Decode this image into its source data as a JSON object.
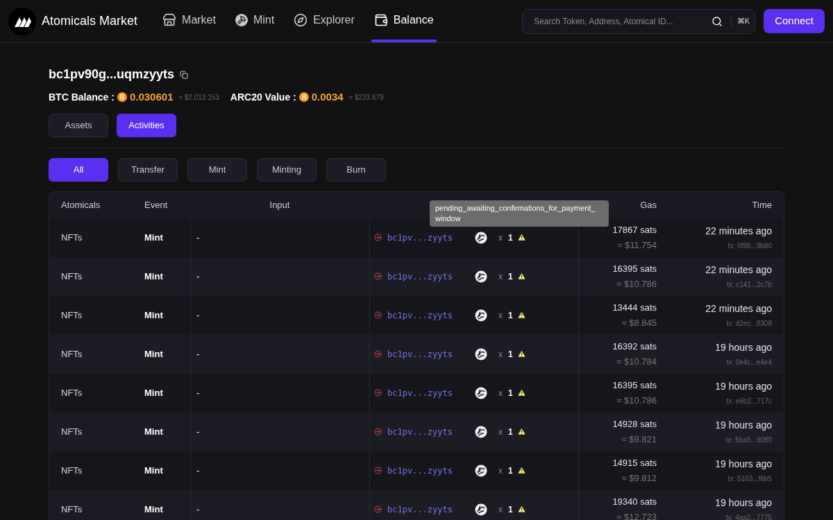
{
  "nav": {
    "brand": "Atomicals Market",
    "items": [
      {
        "label": "Market",
        "kind": "market",
        "selected": false
      },
      {
        "label": "Mint",
        "kind": "mint",
        "selected": false
      },
      {
        "label": "Explorer",
        "kind": "explorer",
        "selected": false
      },
      {
        "label": "Balance",
        "kind": "balance",
        "selected": true
      }
    ],
    "search": {
      "placeholder": "Search Token, Address, Atomical ID...",
      "shortcut": "⌘K"
    },
    "connect": "Connect"
  },
  "wallet": {
    "address": "bc1pv90g...uqmzyyts",
    "balances": [
      {
        "label": "BTC Balance :",
        "value": "0.030601",
        "usd": "≈ $2,013.153"
      },
      {
        "label": "ARC20 Value :",
        "value": "0.0034",
        "usd": "≈ $223.679"
      }
    ]
  },
  "tabs": [
    {
      "label": "Assets",
      "selected": false
    },
    {
      "label": "Activities",
      "selected": true
    }
  ],
  "filters": [
    {
      "label": "All",
      "selected": true
    },
    {
      "label": "Transfer",
      "selected": false
    },
    {
      "label": "Mint",
      "selected": false
    },
    {
      "label": "Minting",
      "selected": false
    },
    {
      "label": "Burn",
      "selected": false
    }
  ],
  "table": {
    "columns": [
      "Atomicals",
      "Event",
      "Input",
      "Gas",
      "Time"
    ],
    "tooltip": "pending_awaiting_confirmations_for_payment_ window",
    "rows": [
      {
        "atomicals": "NFTs",
        "event": "Mint",
        "input": "-",
        "output": "bc1pv...zyyts",
        "multiplier": "x",
        "count": "1",
        "gas": "17867 sats",
        "gas_usd": "≈ $11.754",
        "time": "22 minutes ago",
        "tx": "tx: 6f99...9b80"
      },
      {
        "atomicals": "NFTs",
        "event": "Mint",
        "input": "-",
        "output": "bc1pv...zyyts",
        "multiplier": "x",
        "count": "1",
        "gas": "16395 sats",
        "gas_usd": "≈ $10.786",
        "time": "22 minutes ago",
        "tx": "tx: c141...2c7b"
      },
      {
        "atomicals": "NFTs",
        "event": "Mint",
        "input": "-",
        "output": "bc1pv...zyyts",
        "multiplier": "x",
        "count": "1",
        "gas": "13444 sats",
        "gas_usd": "≈ $8.845",
        "time": "22 minutes ago",
        "tx": "tx: d2ec...8308"
      },
      {
        "atomicals": "NFTs",
        "event": "Mint",
        "input": "-",
        "output": "bc1pv...zyyts",
        "multiplier": "x",
        "count": "1",
        "gas": "16392 sats",
        "gas_usd": "≈ $10.784",
        "time": "19 hours ago",
        "tx": "tx: 0e4c...e4e4"
      },
      {
        "atomicals": "NFTs",
        "event": "Mint",
        "input": "-",
        "output": "bc1pv...zyyts",
        "multiplier": "x",
        "count": "1",
        "gas": "16395 sats",
        "gas_usd": "≈ $10.786",
        "time": "19 hours ago",
        "tx": "tx: e6b2...717c"
      },
      {
        "atomicals": "NFTs",
        "event": "Mint",
        "input": "-",
        "output": "bc1pv...zyyts",
        "multiplier": "x",
        "count": "1",
        "gas": "14928 sats",
        "gas_usd": "≈ $9.821",
        "time": "19 hours ago",
        "tx": "tx: 5ba9...9080"
      },
      {
        "atomicals": "NFTs",
        "event": "Mint",
        "input": "-",
        "output": "bc1pv...zyyts",
        "multiplier": "x",
        "count": "1",
        "gas": "14915 sats",
        "gas_usd": "≈ $9.812",
        "time": "19 hours ago",
        "tx": "tx: 5103...f6b5"
      },
      {
        "atomicals": "NFTs",
        "event": "Mint",
        "input": "-",
        "output": "bc1pv...zyyts",
        "multiplier": "x",
        "count": "1",
        "gas": "19340 sats",
        "gas_usd": "≈ $12.723",
        "time": "19 hours ago",
        "tx": "tx: 4aa2...7775"
      }
    ]
  }
}
